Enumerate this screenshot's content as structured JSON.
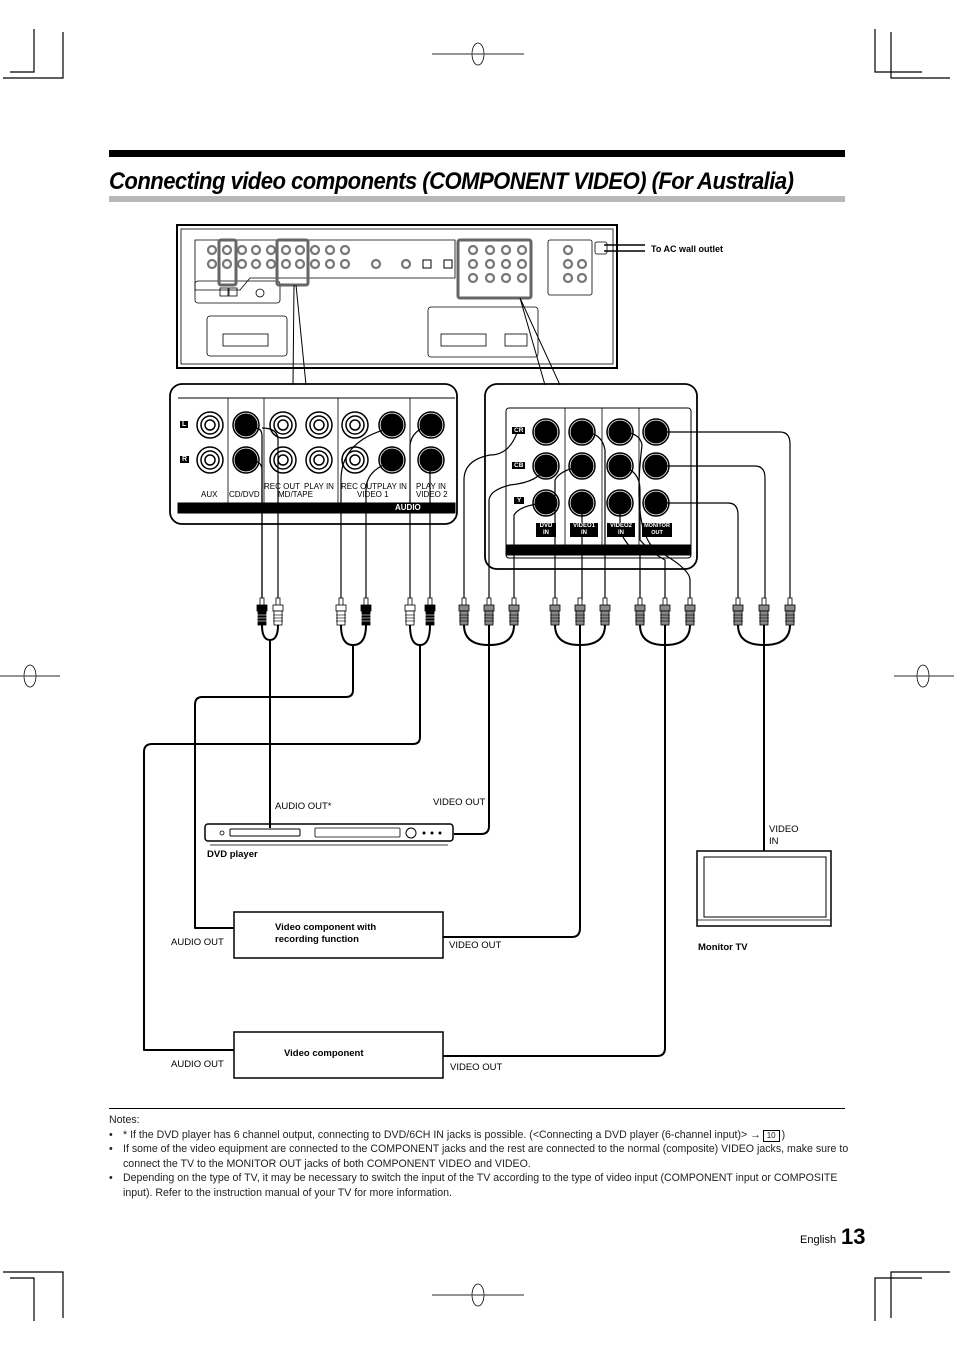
{
  "page": {
    "title": "Connecting video components (COMPONENT VIDEO) (For Australia)",
    "language": "English",
    "page_number": "13"
  },
  "receiver": {
    "ac_outlet_label": "To AC wall outlet"
  },
  "audio_panel": {
    "channel_labels": [
      "L",
      "R"
    ],
    "jack_groups": [
      "AUX",
      "CD/DVD",
      "REC OUT",
      "PLAY IN",
      "REC OUT",
      "PLAY IN",
      "PLAY IN"
    ],
    "group_sublabels": [
      "MD/TAPE",
      "VIDEO 1",
      "VIDEO 2"
    ],
    "bar_label": "AUDIO"
  },
  "component_panel": {
    "row_labels": [
      "CR",
      "CB",
      "Y"
    ],
    "column_labels": [
      "DVD IN",
      "VIDEO1 IN",
      "VIDEO2 IN",
      "MONITOR OUT"
    ]
  },
  "devices": {
    "dvd_player": {
      "name": "DVD player",
      "audio_out": "AUDIO OUT*",
      "video_out": "VIDEO OUT"
    },
    "recorder": {
      "name_line1": "Video component with",
      "name_line2": "recording function",
      "audio_out": "AUDIO OUT",
      "video_out": "VIDEO OUT"
    },
    "video_component": {
      "name": "Video component",
      "audio_out": "AUDIO OUT",
      "video_out": "VIDEO OUT"
    },
    "monitor_tv": {
      "name": "Monitor TV",
      "video_in_line1": "VIDEO",
      "video_in_line2": "IN"
    }
  },
  "notes": {
    "heading": "Notes:",
    "items": [
      {
        "text": "* If the DVD player has 6 channel output, connecting to DVD/6CH IN jacks is possible. (<Connecting a DVD player (6-channel input)> →",
        "ref_page": "10",
        "suffix": ")"
      },
      {
        "text": "If some of the video equipment are connected to the COMPONENT jacks and the rest are connected to the normal (composite) VIDEO jacks, make sure to connect the TV to the MONITOR  OUT jacks of both COMPONENT VIDEO and VIDEO."
      },
      {
        "text": "Depending on the type of TV, it may be necessary to switch the input of the TV according to the type of video input (COMPONENT input or COMPOSITE input). Refer to the instruction manual of your TV for more information."
      }
    ]
  }
}
